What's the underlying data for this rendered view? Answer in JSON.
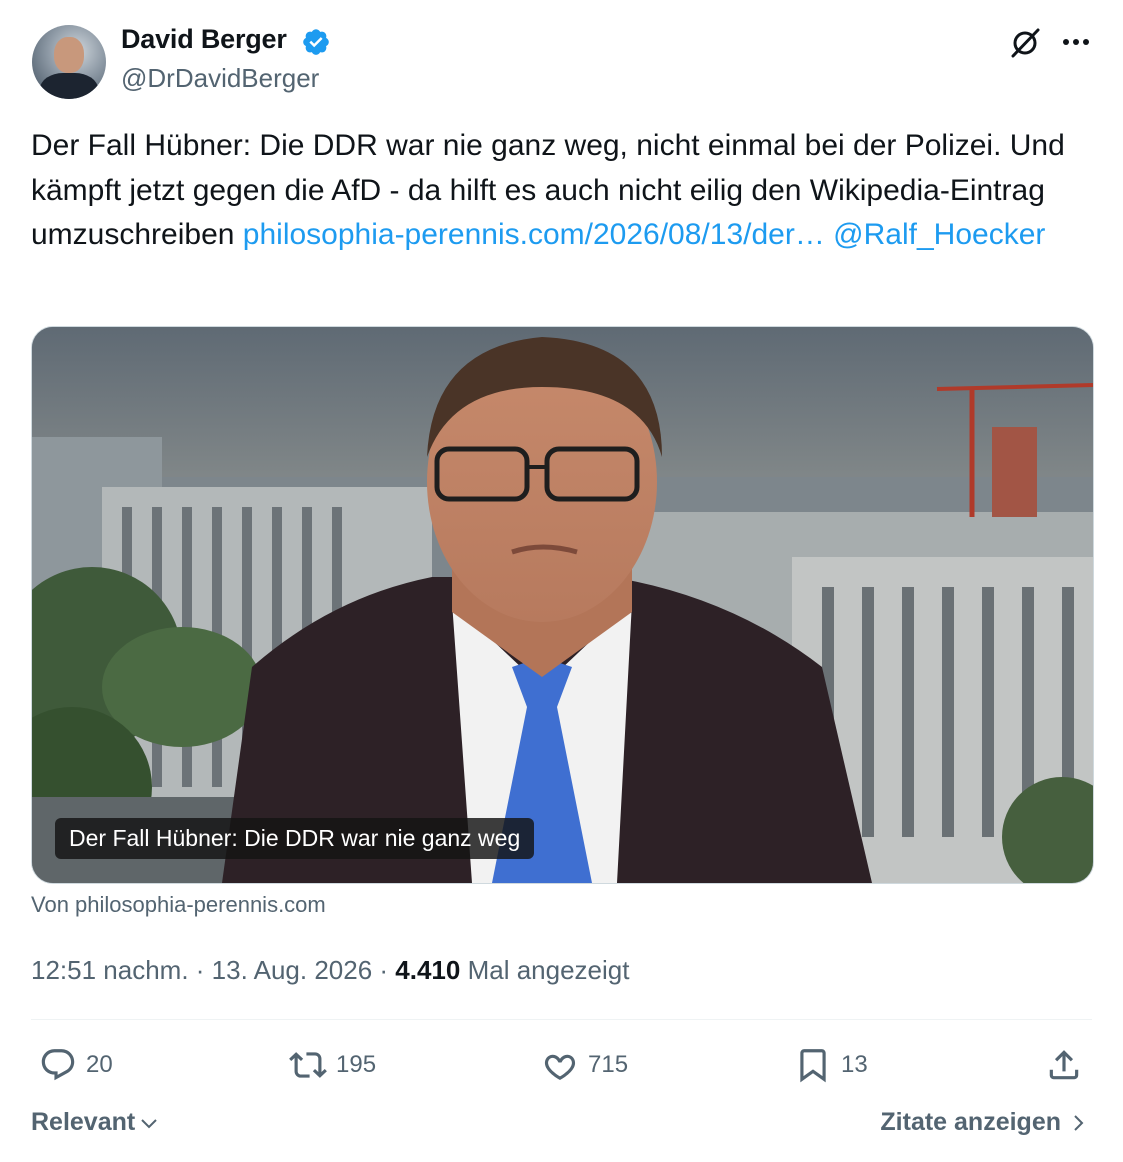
{
  "author": {
    "name": "David Berger",
    "handle": "@DrDavidBerger",
    "verified_color": "#1d9bf0"
  },
  "tweet": {
    "text": "Der Fall Hübner: Die DDR war nie ganz weg, nicht einmal bei der Polizei. Und kämpft jetzt gegen die AfD - da hilft es auch nicht eilig den Wikipedia-Eintrag umzuschreiben ",
    "link": "philosophia-perennis.com/2026/08/13/der…",
    "mention": "@Ralf_Hoecker"
  },
  "card": {
    "caption": "Der Fall Hübner: Die DDR war nie ganz weg",
    "source": "Von philosophia-perennis.com"
  },
  "meta": {
    "time": "12:51 nachm.",
    "date": "13. Aug. 2026",
    "views": "4.410",
    "views_label": "Mal angezeigt"
  },
  "actions": {
    "replies": "20",
    "reposts": "195",
    "likes": "715",
    "bookmarks": "13"
  },
  "footer": {
    "sort_label": "Relevant",
    "quotes_label": "Zitate anzeigen"
  },
  "icons": [
    "verified-badge-icon",
    "grok-icon",
    "more-icon",
    "reply-icon",
    "repost-icon",
    "like-icon",
    "bookmark-icon",
    "share-icon",
    "chevron-down-icon",
    "chevron-right-icon"
  ],
  "colors": {
    "link": "#1d9bf0",
    "text": "#0f1419",
    "secondary": "#536471"
  }
}
